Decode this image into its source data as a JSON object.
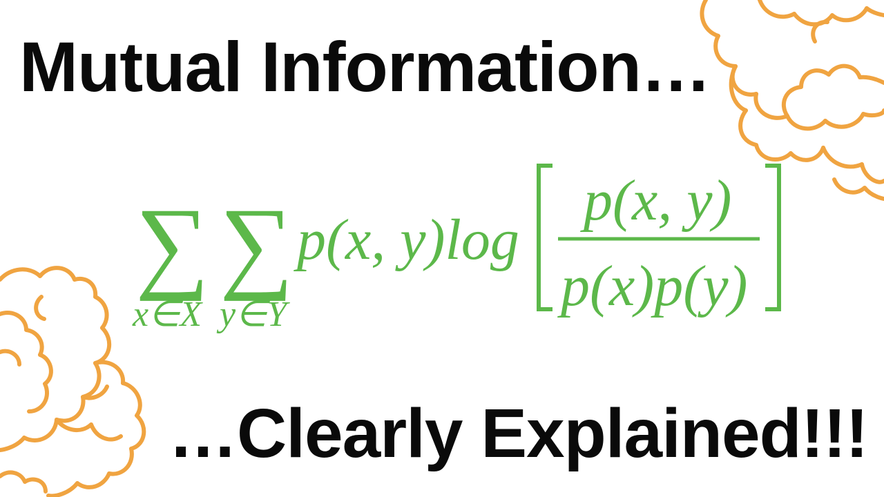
{
  "title": "Mutual Information…",
  "subtitle": "…Clearly Explained!!!",
  "colors": {
    "formula": "#5cb84a",
    "popcorn": "#f0a441",
    "text": "#0a0a0a",
    "background": "#ffffff"
  },
  "formula": {
    "sum_symbol": "∑",
    "sum1_index": "x∈X",
    "sum2_index": "y∈Y",
    "term": "p(x, y)log",
    "numerator": "p(x, y)",
    "denominator": "p(x)p(y)"
  },
  "decorations": [
    "popcorn-cloud-top-right",
    "popcorn-cloud-bottom-left"
  ]
}
